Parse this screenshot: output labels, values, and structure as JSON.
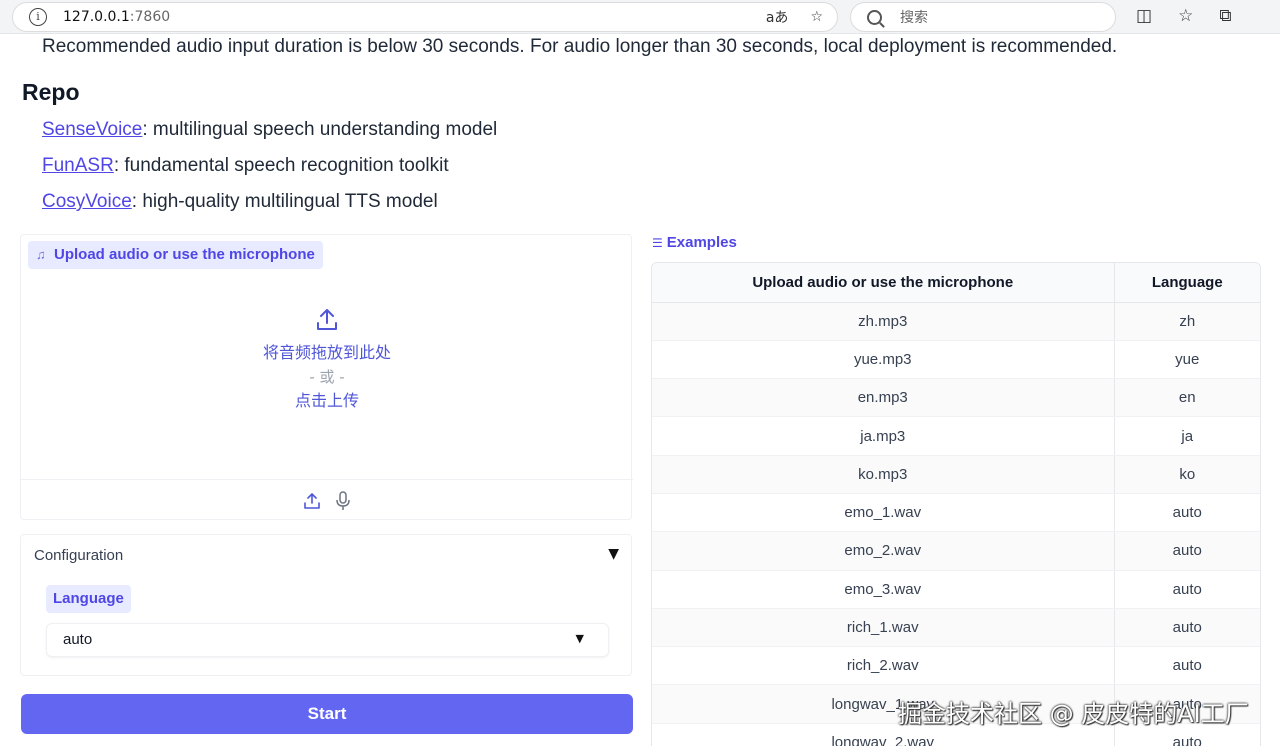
{
  "browser": {
    "url_host": "127.0.0.1",
    "url_port": ":7860",
    "search_placeholder": "搜索",
    "read_aloud_label": "aあ"
  },
  "notice": "Recommended audio input duration is below 30 seconds. For audio longer than 30 seconds, local deployment is recommended.",
  "repo": {
    "heading": "Repo",
    "items": [
      {
        "link": "SenseVoice",
        "desc": ": multilingual speech understanding model"
      },
      {
        "link": "FunASR",
        "desc": ": fundamental speech recognition toolkit"
      },
      {
        "link": "CosyVoice",
        "desc": ": high-quality multilingual TTS model"
      }
    ]
  },
  "upload": {
    "label": "Upload audio or use the microphone",
    "drop_text": "将音频拖放到此处",
    "or_text": "- 或 -",
    "click_text": "点击上传"
  },
  "config": {
    "title": "Configuration",
    "language_label": "Language",
    "language_value": "auto"
  },
  "start_label": "Start",
  "examples": {
    "label": "Examples",
    "headers": [
      "Upload audio or use the microphone",
      "Language"
    ],
    "rows": [
      [
        "zh.mp3",
        "zh"
      ],
      [
        "yue.mp3",
        "yue"
      ],
      [
        "en.mp3",
        "en"
      ],
      [
        "ja.mp3",
        "ja"
      ],
      [
        "ko.mp3",
        "ko"
      ],
      [
        "emo_1.wav",
        "auto"
      ],
      [
        "emo_2.wav",
        "auto"
      ],
      [
        "emo_3.wav",
        "auto"
      ],
      [
        "rich_1.wav",
        "auto"
      ],
      [
        "rich_2.wav",
        "auto"
      ],
      [
        "longwav_1.wav",
        "auto"
      ],
      [
        "longwav_2.wav",
        "auto"
      ]
    ]
  },
  "watermark": "掘金技术社区 @ 皮皮特的AI工厂",
  "colors": {
    "accent": "#6366f1",
    "accent_text": "#4f46e5",
    "chip_bg": "#e8ebff"
  }
}
